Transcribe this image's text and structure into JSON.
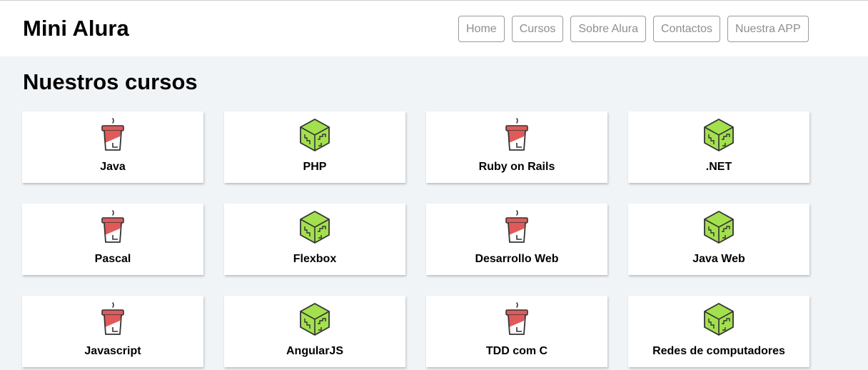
{
  "header": {
    "logo": "Mini Alura",
    "nav": [
      "Home",
      "Cursos",
      "Sobre Alura",
      "Contactos",
      "Nuestra APP"
    ]
  },
  "main": {
    "title": "Nuestros cursos",
    "courses": [
      {
        "label": "Java",
        "icon": "coffee-cup-icon"
      },
      {
        "label": "PHP",
        "icon": "cube-icon"
      },
      {
        "label": "Ruby on Rails",
        "icon": "coffee-cup-icon"
      },
      {
        "label": ".NET",
        "icon": "cube-icon"
      },
      {
        "label": "Pascal",
        "icon": "coffee-cup-icon"
      },
      {
        "label": "Flexbox",
        "icon": "cube-icon"
      },
      {
        "label": "Desarrollo Web",
        "icon": "coffee-cup-icon"
      },
      {
        "label": "Java Web",
        "icon": "cube-icon"
      },
      {
        "label": "Javascript",
        "icon": "coffee-cup-icon"
      },
      {
        "label": "AngularJS",
        "icon": "cube-icon"
      },
      {
        "label": "TDD com C",
        "icon": "coffee-cup-icon"
      },
      {
        "label": "Redes de computadores",
        "icon": "cube-icon"
      }
    ]
  },
  "colors": {
    "cup_red": "#e05a5a",
    "cube_green": "#a3e04e",
    "outline": "#333333",
    "page_bg": "#f1f4f7"
  }
}
